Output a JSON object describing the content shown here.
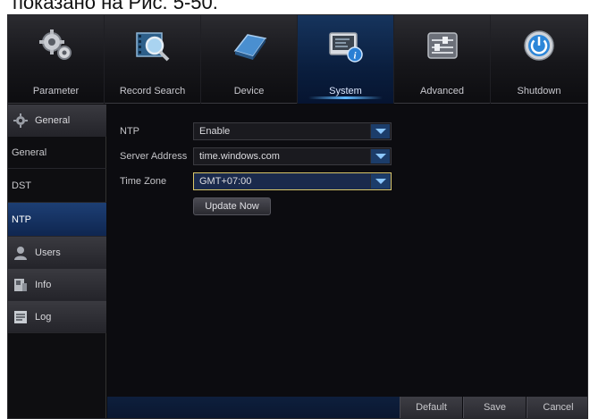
{
  "caption": "показано на Рис. 5-50.",
  "tabs": [
    {
      "label": "Parameter"
    },
    {
      "label": "Record Search"
    },
    {
      "label": "Device"
    },
    {
      "label": "System"
    },
    {
      "label": "Advanced"
    },
    {
      "label": "Shutdown"
    }
  ],
  "active_tab": "System",
  "sidebar": {
    "items": [
      {
        "label": "General",
        "kind": "header",
        "icon": "gear-icon"
      },
      {
        "label": "General",
        "kind": "sub"
      },
      {
        "label": "DST",
        "kind": "sub"
      },
      {
        "label": "NTP",
        "kind": "sub-active"
      },
      {
        "label": "Users",
        "kind": "header",
        "icon": "user-icon"
      },
      {
        "label": "Info",
        "kind": "header",
        "icon": "info-icon"
      },
      {
        "label": "Log",
        "kind": "header",
        "icon": "log-icon"
      }
    ]
  },
  "form": {
    "ntp": {
      "label": "NTP",
      "value": "Enable"
    },
    "server": {
      "label": "Server Address",
      "value": "time.windows.com"
    },
    "timezone": {
      "label": "Time Zone",
      "value": "GMT+07:00"
    },
    "update_button": "Update Now"
  },
  "footer": {
    "default": "Default",
    "save": "Save",
    "cancel": "Cancel"
  },
  "colors": {
    "accent": "#1c3d6a",
    "focus_border": "#d9c76a",
    "active_tab": "#0a1e3e"
  }
}
